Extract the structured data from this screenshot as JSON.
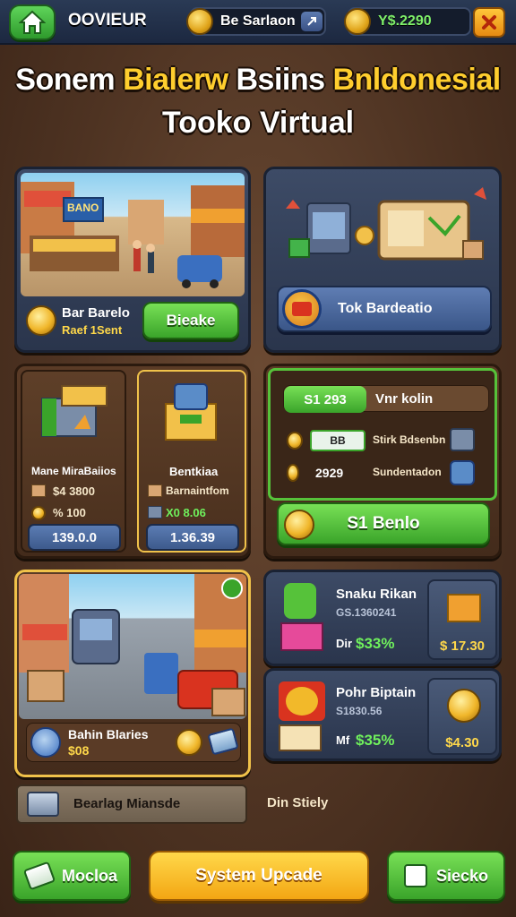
{
  "header": {
    "brand": "OOVIEUR",
    "coins_label": "Be Sarlaon",
    "balance": "Y$.2290"
  },
  "title": {
    "line1_a": "Sonem ",
    "line1_b": "Bialerw ",
    "line1_c": "Bsiins ",
    "line1_d": "Bnldonesial",
    "line2": "Tooko Virtual"
  },
  "panel_market": {
    "name": "Bar Barelo",
    "sub": "Raef 1Sent",
    "button": "Bieake",
    "shop_sign": "BANO"
  },
  "panel_gadgets": {
    "button": "Tok Bardeatio"
  },
  "panel_crates": {
    "left_title": "Mane MiraBaiios",
    "left_row1": "$4 3800",
    "left_row2": "% 100",
    "left_price": "139.0.0",
    "right_title": "Bentkiaa",
    "right_row1": "Barnaintfom",
    "right_row2": "X0 8.06",
    "right_price": "1.36.39"
  },
  "panel_trade": {
    "tag_value": "S1 293",
    "tag_label": "Vnr kolin",
    "row1_chip": "BB",
    "row1_label": "Stirk Bdsenbn",
    "row2_value": "2929",
    "row2_label": "Sundentadon",
    "button": "S1 Benlo"
  },
  "panel_street": {
    "label": "Bahin Blaries",
    "value": "$08"
  },
  "offers": [
    {
      "title": "Snaku Rikan",
      "sub": "GS.1360241",
      "prefix": "Dir",
      "percent": "$33%",
      "price": "$ 17.30"
    },
    {
      "title": "Pohr Biptain",
      "sub": "S1830.56",
      "prefix": "Mf",
      "percent": "$35%",
      "price": "$4.30"
    }
  ],
  "info_bar": {
    "label": "Bearlag Miansde",
    "side": "Din Stiely"
  },
  "footer": {
    "left": "Mocloa",
    "center": "System Upcade",
    "right": "Siecko"
  }
}
